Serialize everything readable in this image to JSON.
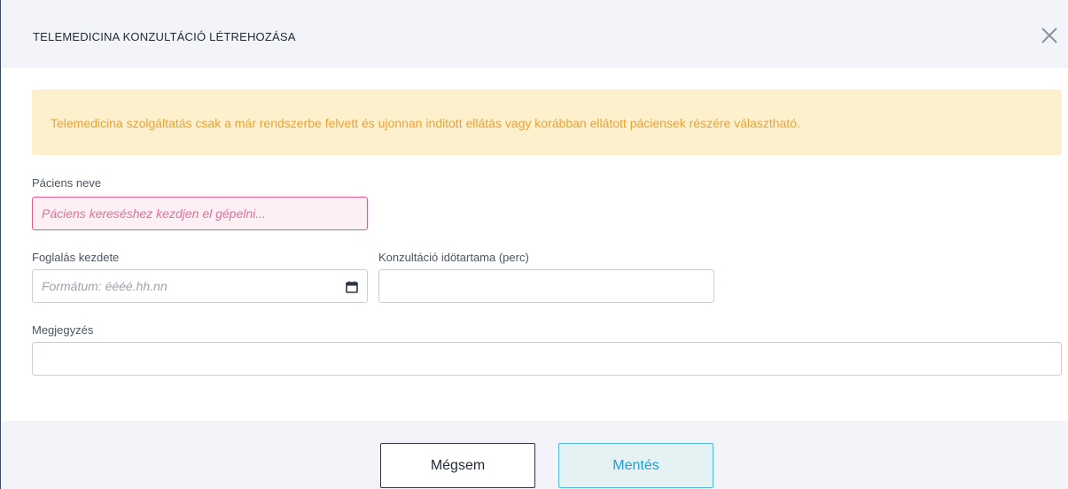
{
  "modal": {
    "title": "TELEMEDICINA KONZULTÁCIÓ LÉTREHOZÁSA",
    "close_icon": "close-icon"
  },
  "alert": {
    "text": "Telemedicina szolgáltatás csak a már rendszerbe felvett és ujonnan inditott ellátás vagy korábban ellátott páciensek részére választható.",
    "color": "#f0a032",
    "background": "#fcf1cc"
  },
  "form": {
    "patient": {
      "label": "Páciens neve",
      "placeholder": "Páciens kereséshez kezdjen el gépelni...",
      "value": ""
    },
    "start": {
      "label": "Foglalás kezdete",
      "placeholder": "Formátum: éééé.hh.nn",
      "value": "",
      "icon": "calendar-icon"
    },
    "duration": {
      "label": "Konzultáció idötartama (perc)",
      "placeholder": "",
      "value": ""
    },
    "note": {
      "label": "Megjegyzés",
      "placeholder": "",
      "value": ""
    }
  },
  "footer": {
    "cancel_label": "Mégsem",
    "save_label": "Mentés",
    "save_color": "#1ea0d6"
  }
}
